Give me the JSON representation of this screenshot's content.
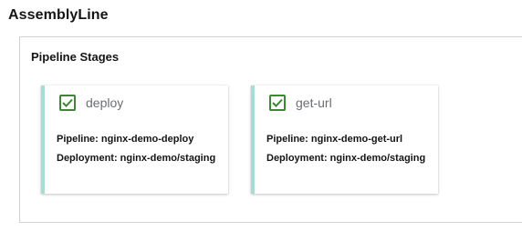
{
  "app": {
    "title": "AssemblyLine"
  },
  "panel": {
    "title": "Pipeline Stages"
  },
  "stages": [
    {
      "name": "deploy",
      "status_icon": "check-square-icon",
      "pipeline": "Pipeline: nginx-demo-deploy",
      "deployment": "Deployment: nginx-demo/staging"
    },
    {
      "name": "get-url",
      "status_icon": "check-square-icon",
      "pipeline": "Pipeline: nginx-demo-get-url",
      "deployment": "Deployment: nginx-demo/staging"
    }
  ],
  "colors": {
    "success": "#3e8635",
    "card_accent": "#a8dcd5",
    "border": "#d2d2d2"
  }
}
